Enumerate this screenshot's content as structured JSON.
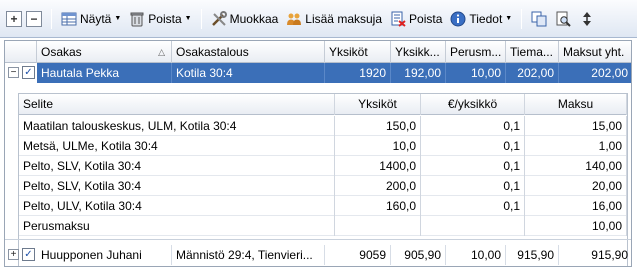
{
  "toolbar": {
    "nayta": "Näytä",
    "poista1": "Poista",
    "muokkaa": "Muokkaa",
    "lisaa_maksuja": "Lisää maksuja",
    "poista2": "Poista",
    "tiedot": "Tiedot"
  },
  "grid": {
    "columns": [
      "Osakas",
      "Osakastalous",
      "Yksiköt",
      "Yksikk...",
      "Perusm...",
      "Tiema...",
      "Maksut yht."
    ],
    "rows": [
      {
        "osakas": "Hautala Pekka",
        "osakastalous": "Kotila 30:4",
        "yksikot": "1920",
        "yksikkohinta": "192,00",
        "perusmaksu": "10,00",
        "tiemaksu": "202,00",
        "maksut": "202,00",
        "checked": true,
        "expanded": true
      },
      {
        "osakas": "Huupponen Juhani",
        "osakastalous": "Männistö 29:4, Tienvieri...",
        "yksikot": "9059",
        "yksikkohinta": "905,90",
        "perusmaksu": "10,00",
        "tiemaksu": "915,90",
        "maksut": "915,90",
        "checked": true,
        "expanded": false
      }
    ]
  },
  "detail": {
    "columns": [
      "Selite",
      "Yksiköt",
      "€/yksikkö",
      "Maksu"
    ],
    "rows": [
      {
        "selite": "Maatilan talouskeskus, ULM, Kotila 30:4",
        "yksikot": "150,0",
        "per": "0,1",
        "maksu": "15,00"
      },
      {
        "selite": "Metsä, ULMe, Kotila 30:4",
        "yksikot": "10,0",
        "per": "0,1",
        "maksu": "1,00"
      },
      {
        "selite": "Pelto, SLV, Kotila 30:4",
        "yksikot": "1400,0",
        "per": "0,1",
        "maksu": "140,00"
      },
      {
        "selite": "Pelto, SLV, Kotila 30:4",
        "yksikot": "200,0",
        "per": "0,1",
        "maksu": "20,00"
      },
      {
        "selite": "Pelto, ULV, Kotila 30:4",
        "yksikot": "160,0",
        "per": "0,1",
        "maksu": "16,00"
      },
      {
        "selite": "Perusmaksu",
        "yksikot": "",
        "per": "",
        "maksu": "10,00"
      }
    ]
  }
}
